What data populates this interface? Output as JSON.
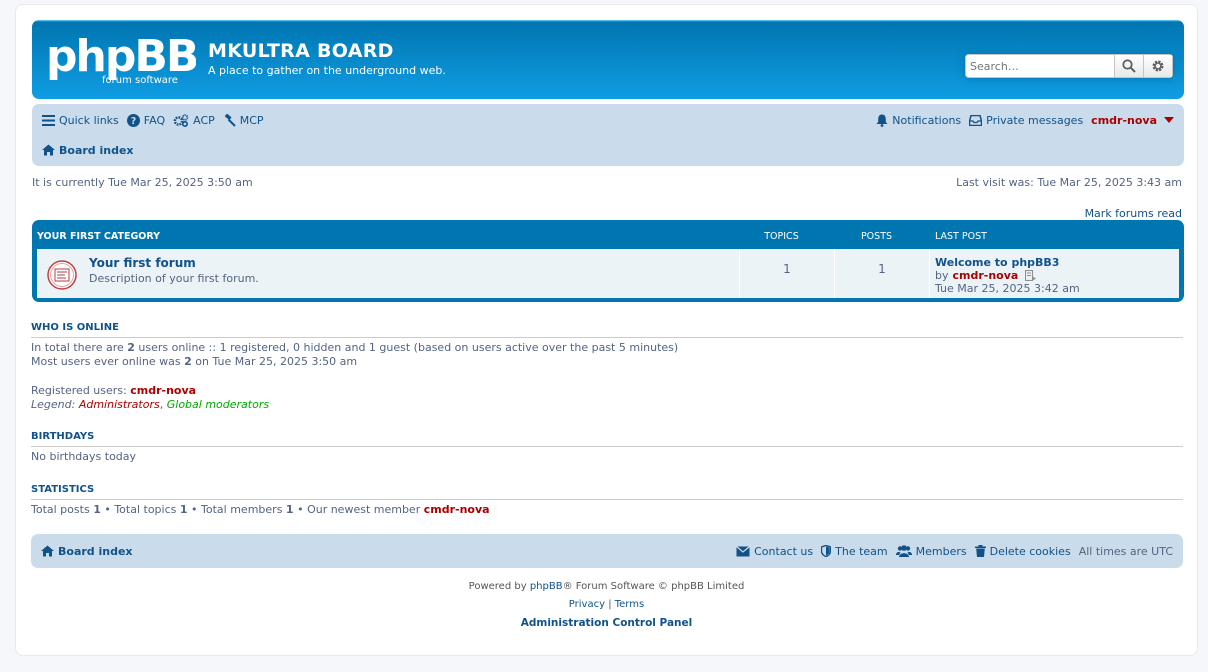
{
  "header": {
    "logo_text": "phpBB",
    "logo_sub": "forum software",
    "site_title": "MKULTRA BOARD",
    "site_desc": "A place to gather on the underground web.",
    "search_placeholder": "Search…"
  },
  "navbar": {
    "quick_links": "Quick links",
    "faq": "FAQ",
    "acp": "ACP",
    "mcp": "MCP",
    "notifications": "Notifications",
    "private_messages": "Private messages",
    "username": "cmdr-nova",
    "board_index": "Board index"
  },
  "status": {
    "current_time": "It is currently Tue Mar 25, 2025 3:50 am",
    "last_visit": "Last visit was: Tue Mar 25, 2025 3:43 am",
    "mark_read": "Mark forums read"
  },
  "forumlist": {
    "category": "YOUR FIRST CATEGORY",
    "col_topics": "TOPICS",
    "col_posts": "POSTS",
    "col_lastpost": "LAST POST",
    "forums": [
      {
        "title": "Your first forum",
        "description": "Description of your first forum.",
        "topics": "1",
        "posts": "1",
        "last_post_title": "Welcome to phpBB3",
        "last_post_by": "by",
        "last_post_author": "cmdr-nova",
        "last_post_time": "Tue Mar 25, 2025 3:42 am"
      }
    ]
  },
  "who_online": {
    "heading": "WHO IS ONLINE",
    "line1_pre": "In total there are",
    "line1_count": "2",
    "line1_post": "users online :: 1 registered, 0 hidden and 1 guest (based on users active over the past 5 minutes)",
    "line2_pre": "Most users ever online was",
    "line2_count": "2",
    "line2_post": "on Tue Mar 25, 2025 3:50 am",
    "registered_label": "Registered users:",
    "registered_user": "cmdr-nova",
    "legend_label": "Legend:",
    "legend_admin": "Administrators",
    "legend_sep": ",",
    "legend_gmod": "Global moderators"
  },
  "birthdays": {
    "heading": "BIRTHDAYS",
    "text": "No birthdays today"
  },
  "statistics": {
    "heading": "STATISTICS",
    "posts_label": "Total posts",
    "posts": "1",
    "topics_label": "• Total topics",
    "topics": "1",
    "members_label": "• Total members",
    "members": "1",
    "newest_label": "• Our newest member",
    "newest": "cmdr-nova"
  },
  "footer": {
    "board_index": "Board index",
    "contact": "Contact us",
    "team": "The team",
    "members": "Members",
    "delete_cookies": "Delete cookies",
    "timezone": "All times are UTC",
    "powered_pre": "Powered by",
    "powered_link": "phpBB",
    "powered_post": "® Forum Software © phpBB Limited",
    "privacy": "Privacy",
    "sep": "|",
    "terms": "Terms",
    "acp_link": "Administration Control Panel"
  },
  "colors": {
    "header_blue": "#0076b1",
    "nav_bg": "#cadceb",
    "link": "#105289",
    "admin_red": "#aa0000",
    "gmod_green": "#00aa00",
    "text": "#536482"
  }
}
